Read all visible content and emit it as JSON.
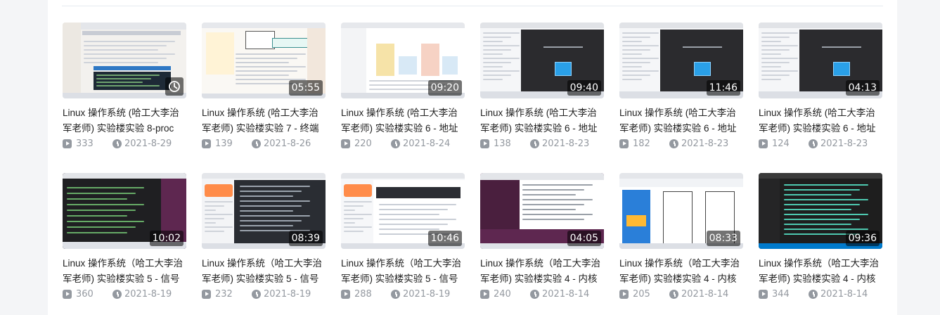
{
  "videos": [
    {
      "title": "Linux 操作系统 (哈工大李治军老师) 实验楼实验 8-proc",
      "duration": "",
      "views": "333",
      "date": "2021-8-29",
      "thumb": "light",
      "watch_later": true
    },
    {
      "title": "Linux 操作系统 (哈工大李治军老师) 实验楼实验 7 - 终端",
      "duration": "05:55",
      "views": "139",
      "date": "2021-8-26",
      "thumb": "diagram"
    },
    {
      "title": "Linux 操作系统 (哈工大李治军老师) 实验楼实验 6 - 地址",
      "duration": "09:20",
      "views": "220",
      "date": "2021-8-24",
      "thumb": "columns"
    },
    {
      "title": "Linux 操作系统 (哈工大李治军老师) 实验楼实验 6 - 地址",
      "duration": "09:40",
      "views": "138",
      "date": "2021-8-23",
      "thumb": "dark-dialog"
    },
    {
      "title": "Linux 操作系统 (哈工大李治军老师) 实验楼实验 6 - 地址",
      "duration": "11:46",
      "views": "182",
      "date": "2021-8-23",
      "thumb": "dark-dialog"
    },
    {
      "title": "Linux 操作系统 (哈工大李治军老师) 实验楼实验 6 - 地址",
      "duration": "04:13",
      "views": "124",
      "date": "2021-8-23",
      "thumb": "dark-dialog"
    },
    {
      "title": "Linux 操作系统（哈工大李治军老师) 实验楼实验 5 - 信号",
      "duration": "10:02",
      "views": "360",
      "date": "2021-8-19",
      "thumb": "terminal"
    },
    {
      "title": "Linux 操作系统（哈工大李治军老师) 实验楼实验 5 - 信号",
      "duration": "08:39",
      "views": "232",
      "date": "2021-8-19",
      "thumb": "split-dark"
    },
    {
      "title": "Linux 操作系统（哈工大李治军老师) 实验楼实验 5 - 信号",
      "duration": "10:46",
      "views": "288",
      "date": "2021-8-19",
      "thumb": "split-light"
    },
    {
      "title": "Linux 操作系统（哈工大李治军老师) 实验楼实验 4 - 内核",
      "duration": "04:05",
      "views": "240",
      "date": "2021-8-14",
      "thumb": "ubuntu"
    },
    {
      "title": "Linux 操作系统（哈工大李治军老师) 实验楼实验 4 - 内核",
      "duration": "08:33",
      "views": "205",
      "date": "2021-8-14",
      "thumb": "paint"
    },
    {
      "title": "Linux 操作系统（哈工大李治军老师) 实验楼实验 4 - 内核",
      "duration": "09:36",
      "views": "344",
      "date": "2021-8-14",
      "thumb": "code-dark"
    }
  ]
}
